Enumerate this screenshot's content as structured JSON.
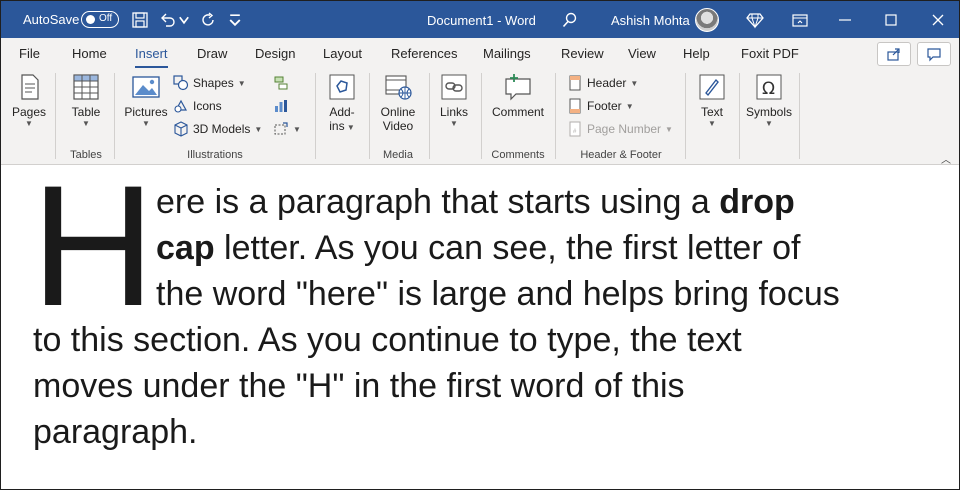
{
  "titlebar": {
    "autosave_label": "AutoSave",
    "autosave_state": "Off",
    "document_title": "Document1  -  Word",
    "user_name": "Ashish Mohta",
    "bg_color": "#2b579a"
  },
  "menu": {
    "tabs": [
      "File",
      "Home",
      "Insert",
      "Draw",
      "Design",
      "Layout",
      "References",
      "Mailings",
      "Review",
      "View",
      "Help",
      "Foxit PDF"
    ],
    "active_tab": "Insert"
  },
  "ribbon": {
    "groups": {
      "pages": {
        "button": "Pages"
      },
      "tables": {
        "button": "Table",
        "label": "Tables"
      },
      "illustrations": {
        "pictures": "Pictures",
        "shapes": "Shapes",
        "icons": "Icons",
        "models": "3D Models",
        "label": "Illustrations"
      },
      "addins": {
        "button_line1": "Add-",
        "button_line2": "ins"
      },
      "media": {
        "button_line1": "Online",
        "button_line2": "Video",
        "label": "Media"
      },
      "links": {
        "button": "Links"
      },
      "comments": {
        "button": "Comment",
        "label": "Comments"
      },
      "header_footer": {
        "header": "Header",
        "footer": "Footer",
        "page_number": "Page Number",
        "label": "Header & Footer"
      },
      "text": {
        "button": "Text"
      },
      "symbols": {
        "button": "Symbols"
      }
    }
  },
  "document": {
    "drop_cap": "H",
    "line1_text": "ere is a paragraph that starts using a ",
    "line1_bold": "drop",
    "line2_bold": "cap",
    "line2_text": " letter. As you can see, the first letter of",
    "line3": "the word \"here\" is large and helps bring focus",
    "line4": "to this section. As you continue to type, the text",
    "line5": "moves under the \"H\" in the first word of this",
    "line6": "paragraph."
  }
}
